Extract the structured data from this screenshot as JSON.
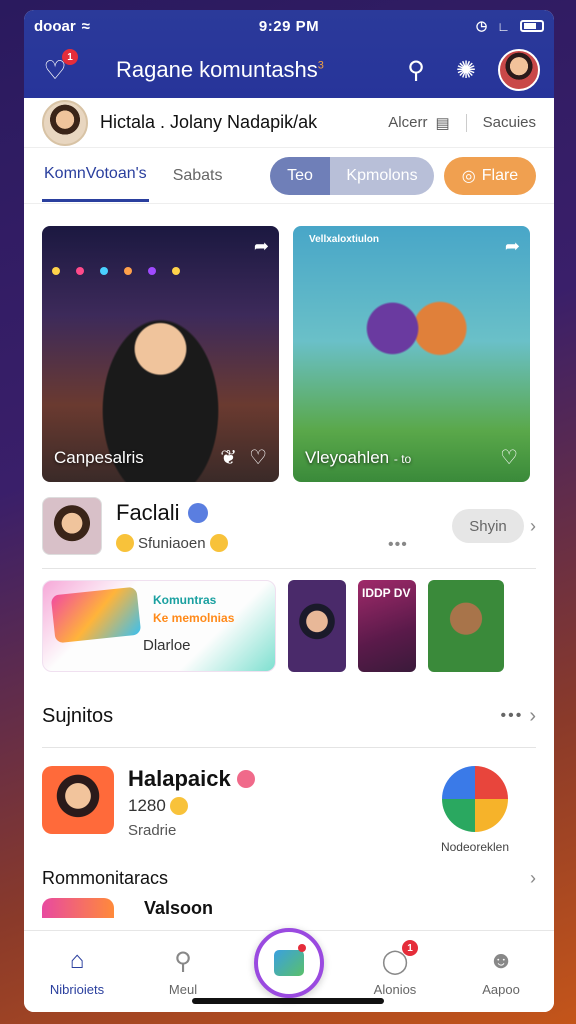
{
  "status_bar": {
    "carrier": "dooar",
    "time": "9:29 PM"
  },
  "header": {
    "title": "Ragane komuntashs",
    "notif_badge": "1",
    "title_badge": "3"
  },
  "profile": {
    "name": "Hictala . Jolany Nadapik/ak",
    "right_label": "Alcerr",
    "right_link": "Sacuies"
  },
  "tabs": [
    {
      "label": "KomnVotoan's",
      "active": true
    },
    {
      "label": "Sabats",
      "active": false
    }
  ],
  "segment": {
    "left": "Teo",
    "right": "Kpmolons"
  },
  "flare_button": "Flare",
  "hero_cards": [
    {
      "label": "Canpesalris"
    },
    {
      "label": "Vleyoahlen",
      "sublabel": "- to",
      "top_label": "Vellxaloxtiulon"
    }
  ],
  "creator": {
    "name": "Faclali",
    "subtitle": "Sfuniaoen",
    "button": "Shyin"
  },
  "promo": {
    "line1": "Komuntras",
    "line2": "Ke memolnias",
    "line3": "Dlarloe",
    "thumb_title": "IDDP DV"
  },
  "section1": {
    "title": "Sujnitos"
  },
  "item": {
    "name": "Halapaick",
    "number": "1280",
    "sub": "Sradrie",
    "logo_label": "Nodeoreklen"
  },
  "section2": {
    "title": "Rommonitaracs"
  },
  "peek": {
    "title": "Valsoon"
  },
  "bottom_nav": [
    {
      "label": "Nibrioiets",
      "icon": "home-icon",
      "active": true
    },
    {
      "label": "Meul",
      "icon": "search-icon",
      "active": false
    },
    {
      "label": "",
      "icon": "create-icon",
      "active": false
    },
    {
      "label": "Alonios",
      "icon": "activity-icon",
      "active": false,
      "badge": "1"
    },
    {
      "label": "Aapoo",
      "icon": "profile-icon",
      "active": false
    }
  ]
}
